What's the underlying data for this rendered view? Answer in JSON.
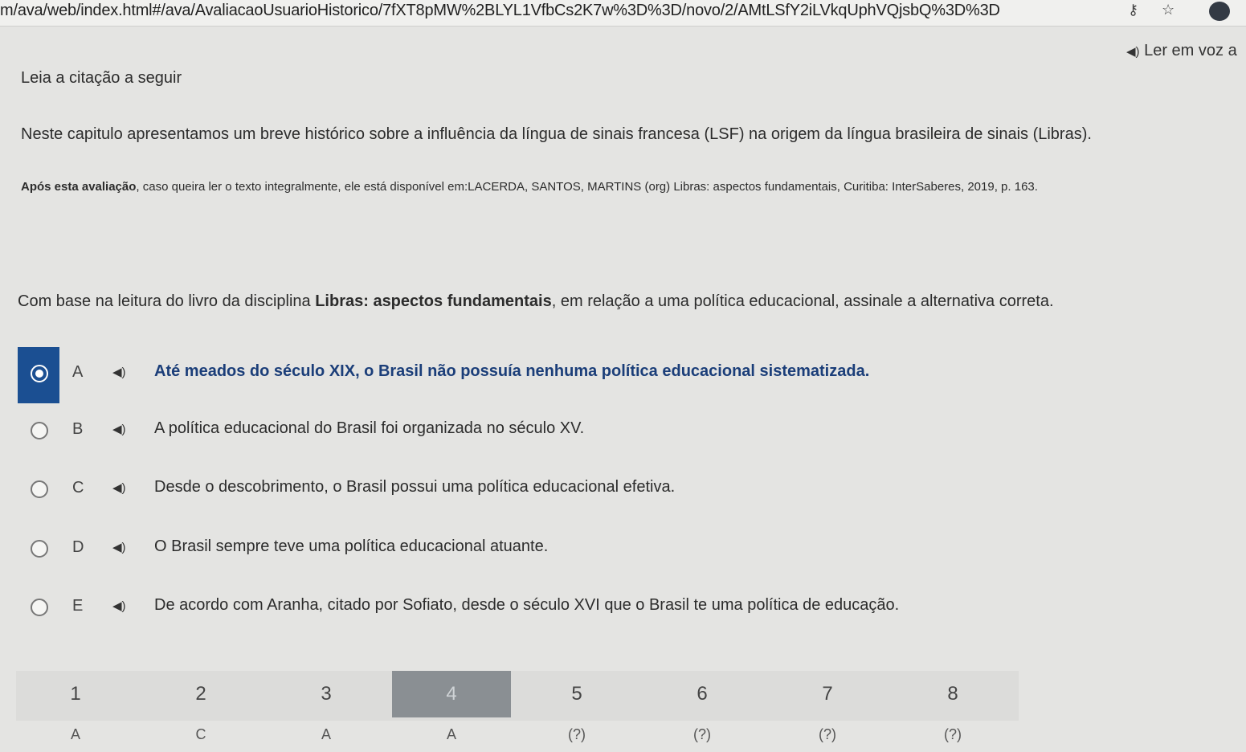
{
  "browser": {
    "url": "m/ava/web/index.html#/ava/AvaliacaoUsuarioHistorico/7fXT8pMW%2BLYL1VfbCs2K7w%3D%3D/novo/2/AMtLSfY2iLVkqUphVQjsbQ%3D%3D",
    "key_icon": "key-icon",
    "star_icon": "star-icon"
  },
  "tts": {
    "label": "Ler em voz a",
    "icon": "speaker-icon"
  },
  "question": {
    "lead": "Leia a citação a seguir",
    "quote": "Neste capitulo apresentamos um breve histórico sobre a influência da língua de sinais francesa (LSF) na origem da língua brasileira de sinais (Libras).",
    "source_bold": "Após esta avaliação",
    "source_rest": ", caso queira ler o texto integralmente, ele está disponível em:LACERDA, SANTOS, MARTINS (org) Libras: aspectos fundamentais, Curitiba: InterSaberes, 2019, p. 163.",
    "prompt_pre": "Com base na leitura  do livro da disciplina ",
    "prompt_bold": "Libras: aspectos fundamentais",
    "prompt_post": ", em relação a uma política educacional,  assinale a alternativa correta."
  },
  "options": [
    {
      "letter": "A",
      "text": "Até meados do século XIX, o Brasil não possuía nenhuma política educacional sistematizada.",
      "selected": true
    },
    {
      "letter": "B",
      "text": "A política educacional do Brasil foi organizada no século XV.",
      "selected": false
    },
    {
      "letter": "C",
      "text": "Desde o descobrimento, o Brasil possui uma política educacional efetiva.",
      "selected": false
    },
    {
      "letter": "D",
      "text": "O Brasil sempre teve uma política educacional atuante.",
      "selected": false
    },
    {
      "letter": "E",
      "text": "De acordo com Aranha, citado por Sofiato, desde o século XVI que o Brasil te uma política de educação.",
      "selected": false
    }
  ],
  "pager": {
    "current": "4",
    "pages": [
      {
        "number": "1",
        "answer": "A"
      },
      {
        "number": "2",
        "answer": "C"
      },
      {
        "number": "3",
        "answer": "A"
      },
      {
        "number": "4",
        "answer": "A"
      },
      {
        "number": "5",
        "answer": "(?)"
      },
      {
        "number": "6",
        "answer": "(?)"
      },
      {
        "number": "7",
        "answer": "(?)"
      },
      {
        "number": "8",
        "answer": "(?)"
      }
    ]
  },
  "colors": {
    "selected": "#1b4f92",
    "background": "#e4e4e2"
  }
}
